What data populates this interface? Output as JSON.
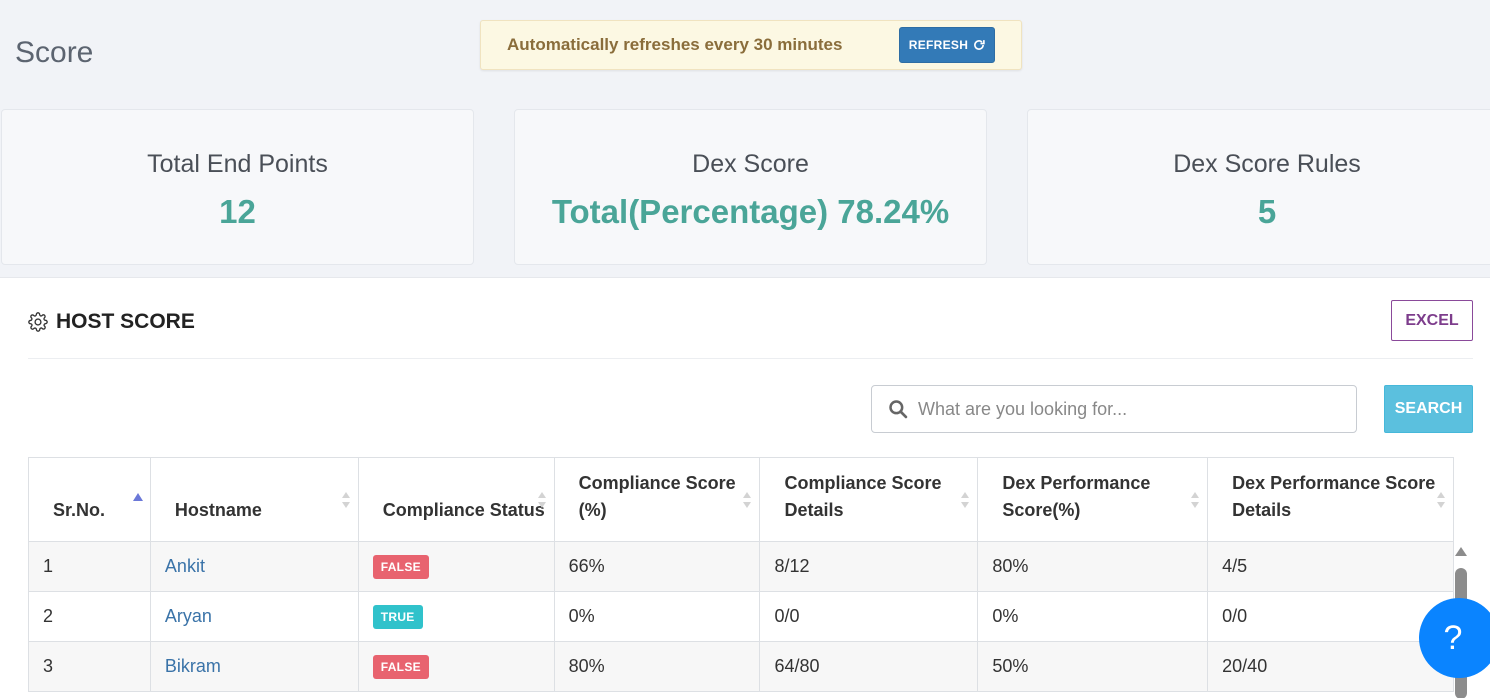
{
  "header": {
    "page_title": "Score",
    "notice_text": "Automatically refreshes every 30 minutes",
    "refresh_label": "REFRESH"
  },
  "cards": [
    {
      "label": "Total End Points",
      "value": "12"
    },
    {
      "label": "Dex Score",
      "value": "Total(Percentage) 78.24%"
    },
    {
      "label": "Dex Score Rules",
      "value": "5"
    }
  ],
  "panel": {
    "title": "HOST SCORE",
    "excel_label": "EXCEL",
    "search_placeholder": "What are you looking for...",
    "search_label": "SEARCH"
  },
  "table": {
    "columns": [
      "Sr.No.",
      "Hostname",
      "Compliance Status",
      "Compliance Score (%)",
      "Compliance Score Details",
      "Dex Performance Score(%)",
      "Dex Performance Score Details"
    ],
    "rows": [
      {
        "sr": "1",
        "host": "Ankit",
        "status": "FALSE",
        "cscore": "66%",
        "cdetails": "8/12",
        "dscore": "80%",
        "ddetails": "4/5"
      },
      {
        "sr": "2",
        "host": "Aryan",
        "status": "TRUE",
        "cscore": "0%",
        "cdetails": "0/0",
        "dscore": "0%",
        "ddetails": "0/0"
      },
      {
        "sr": "3",
        "host": "Bikram",
        "status": "FALSE",
        "cscore": "80%",
        "cdetails": "64/80",
        "dscore": "50%",
        "ddetails": "20/40"
      }
    ]
  },
  "help": {
    "label": "?"
  },
  "colors": {
    "accent_teal": "#4aa598",
    "false_badge": "#e8636f",
    "true_badge": "#30c2cb",
    "refresh_blue": "#337ab7",
    "search_blue": "#5bc0de",
    "excel_purple": "#7d3d8c"
  }
}
